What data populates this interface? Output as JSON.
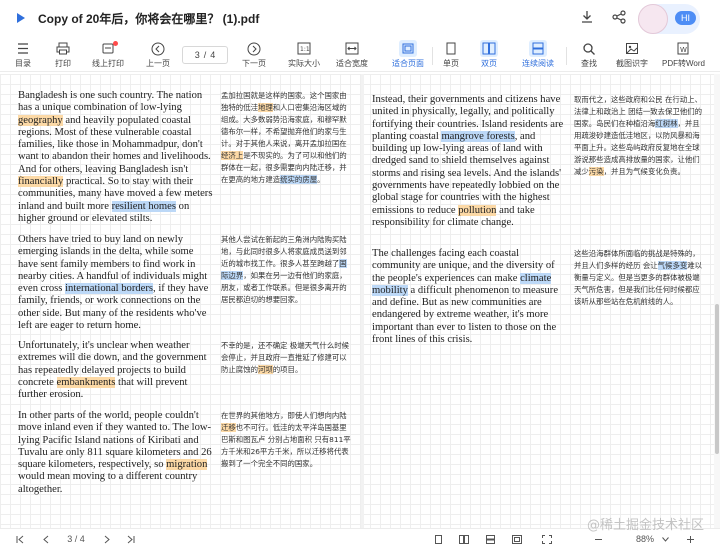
{
  "window": {
    "title": "Copy of 20年后，你将会在哪里？ (1).pdf"
  },
  "mascot": {
    "greeting": "HI"
  },
  "toolbar": {
    "items": [
      {
        "label": "目录"
      },
      {
        "label": "打印"
      },
      {
        "label": "线上打印"
      },
      {
        "label": "上一页"
      },
      {
        "label": "下一页"
      },
      {
        "label": "实际大小"
      },
      {
        "label": "适合宽度"
      },
      {
        "label": "适合页面"
      },
      {
        "label": "单页"
      },
      {
        "label": "双页"
      },
      {
        "label": "连续阅读"
      },
      {
        "label": "查找"
      },
      {
        "label": "截图识字"
      },
      {
        "label": "PDF转Word"
      }
    ],
    "page_current": "3",
    "page_total": "4"
  },
  "left_en": [
    "Bangladesh is one such country. The nation has a unique combination of low-lying geography and heavily populated coastal regions. Most of these vulnerable coastal families, like those in Mohammadpur, don't want to abandon their homes and livelihoods. And for others, leaving Bangladesh isn't financially practical. So to stay with their communities, many have moved a few meters inland and built more resilient homes on higher ground or elevated stilts.",
    "Others have tried to buy land on newly emerging islands in the delta, while some have sent family members to find work in nearby cities. A handful of individuals might even cross international borders, if they have family, friends, or work connections on the other side. But many of the residents who've left are eager to return home.",
    "Unfortunately, it's unclear when weather extremes will die down, and the government has repeatedly delayed projects to build concrete embankments that will prevent further erosion.",
    "In other parts of the world, people couldn't move inland even if they wanted to. The low-lying Pacific Island nations of Kiribati and Tuvalu are only 811 square kilometers and 26 square kilometers, respectively, so migration would mean moving to a different country altogether."
  ],
  "left_zh": [
    "孟加拉国就是这样的国家。这个国家由独特的低洼地理和人口密集沿海区域的组成。大多数弱势沿海家庭，和穆罕默德布尔一样，不希望抛弃他们的家与生计。对于其他人来说，离开孟加拉国在经济上是不现实的。为了可以和他们的群体在一起，很多需要向内陆迁移，并在更高的地方建造统实的房屋。",
    "其他人尝试在新起的三角洲内陆购买陆地，与此同时很多人将家庭成员送到邻近的城市找工作。很多人甚至跨越了国际边界，如果在另一边有他们的家庭，朋友，或者工作联系。但是很多离开的居民都迫切的想要回家。",
    "不幸的是，还不确定 极端天气什么时候会停止，并且政府一直推延了修建可以防止腐蚀的河坝的项目。",
    "在世界的其他地方，即使人们想向内陆迁移也不可行。低洼的太平洋岛国基里巴斯和图瓦卢 分别占地面积 只有811平方千米和26平方千米，所以迁移将代表 搬到了一个完全不同的国家。"
  ],
  "right_en": [
    "Instead, their governments and citizens have united in physically, legally, and politically fortifying their countries. Island residents are planting coastal mangrove forests, and building up low-lying areas of land with dredged sand to shield themselves against storms and rising sea levels. And the islands' governments have repeatedly lobbied on the global stage for countries with the highest emissions to reduce pollution and take responsibility for climate change.",
    "The challenges facing each coastal community are unique, and the diversity of the people's experiences can make climate mobility a difficult phenomenon to measure and define. But as new communities are endangered by extreme weather, it's more important than ever to listen to those on the front lines of this crisis."
  ],
  "right_zh": [
    "取而代之，这些政府和公民 在行动上、法律上和政治上 团结一致去保卫他们的国家。岛民们在种植沿海红树林，并且用疏浚砂建造低洼地区，以防风暴和海平面上升。这些岛屿政府反复地在全球 游说那些造成高排放量的国家，让他们减少污染，并且为气候变化负责。",
    "这些沿海群体所面临的挑战是特殊的，并且人们多样的经历 会让气候多变难以衡量与定义。但是当更多的群体被极端天气所危害，但是我们比任何时候都应该听从那些站在危机前线的人。"
  ],
  "statusbar": {
    "page_current": "3",
    "page_total": "4",
    "zoom": "88%"
  },
  "watermark": "@稀土掘金技术社区"
}
